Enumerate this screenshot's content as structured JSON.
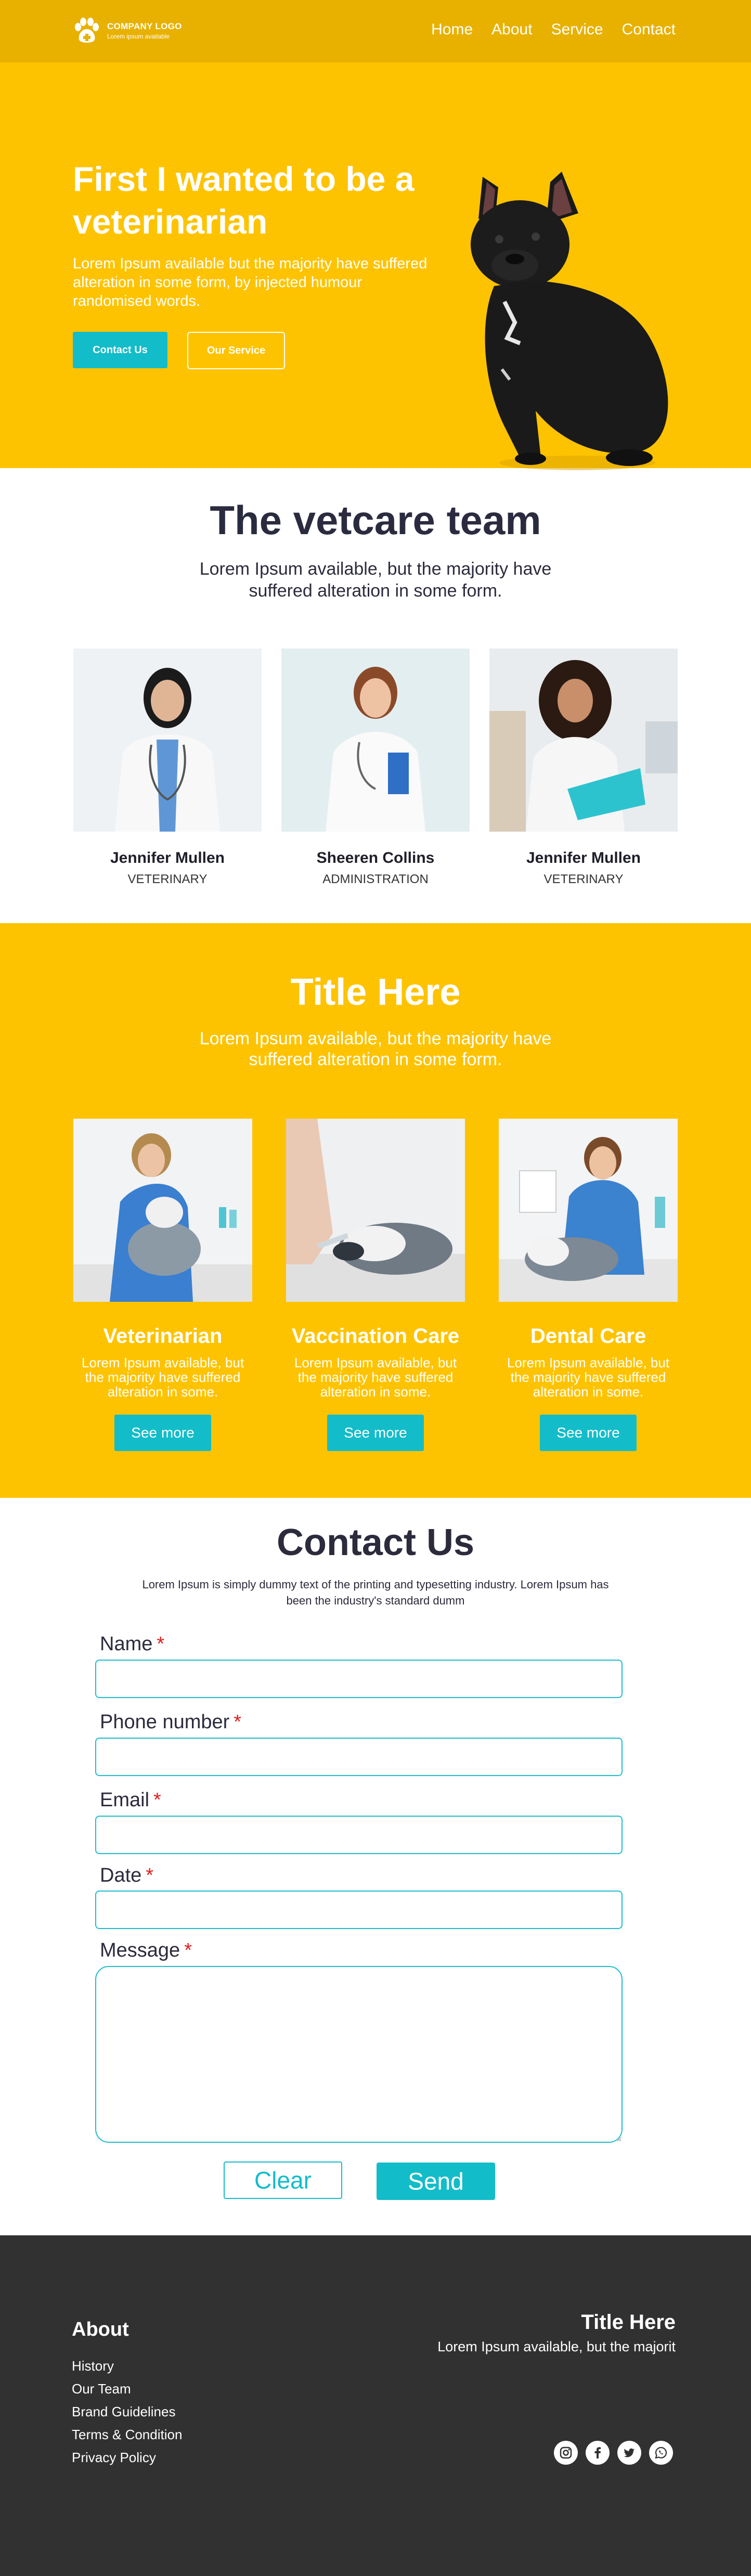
{
  "header": {
    "logo_name": "COMPANY LOGO",
    "logo_tagline": "Lorem ipsum available",
    "nav": [
      "Home",
      "About",
      "Service",
      "Contact"
    ]
  },
  "hero": {
    "title": "First I wanted to be a veterinarian",
    "description": "Lorem Ipsum available but the majority have suffered alteration in some form, by injected humour randomised words.",
    "primary_button": "Contact Us",
    "secondary_button": "Our Service"
  },
  "team": {
    "title": "The vetcare team",
    "description": "Lorem Ipsum available, but the majority have suffered alteration in some form.",
    "members": [
      {
        "name": "Jennifer Mullen",
        "role": "VETERINARY"
      },
      {
        "name": "Sheeren Collins",
        "role": "ADMINISTRATION"
      },
      {
        "name": "Jennifer Mullen",
        "role": "VETERINARY"
      }
    ]
  },
  "services": {
    "title": "Title Here",
    "description": "Lorem Ipsum available, but the majority have suffered alteration in some form.",
    "items": [
      {
        "name": "Veterinarian",
        "description": "Lorem Ipsum available, but the majority have suffered alteration in some.",
        "button": "See more"
      },
      {
        "name": "Vaccination Care",
        "description": "Lorem Ipsum available, but the majority have suffered alteration in some.",
        "button": "See more"
      },
      {
        "name": "Dental Care",
        "description": "Lorem Ipsum available, but the majority have suffered alteration in some.",
        "button": "See more"
      }
    ]
  },
  "contact": {
    "title": "Contact Us",
    "description": "Lorem Ipsum is simply dummy text of the printing and typesetting industry. Lorem Ipsum has been the industry's standard dumm",
    "fields": [
      {
        "label": "Name",
        "required": "*",
        "value": ""
      },
      {
        "label": "Phone number",
        "required": "*",
        "value": ""
      },
      {
        "label": "Email",
        "required": "*",
        "value": ""
      },
      {
        "label": "Date",
        "required": "*",
        "value": ""
      },
      {
        "label": "Message",
        "required": "*",
        "value": ""
      }
    ],
    "clear_button": "Clear",
    "send_button": "Send"
  },
  "footer": {
    "about_title": "About",
    "links": [
      "History",
      "Our Team",
      "Brand Guidelines",
      "Terms & Condition",
      "Privacy Policy"
    ],
    "title": "Title Here",
    "description": "Lorem Ipsum available, but the majorit",
    "socials": [
      "instagram-icon",
      "facebook-icon",
      "twitter-icon",
      "whatsapp-icon"
    ]
  },
  "colors": {
    "header_bg": "#e8b100",
    "brand_yellow": "#fec300",
    "accent_teal": "#13bcc9",
    "footer_bg": "#313131",
    "required_red": "#e02020"
  }
}
